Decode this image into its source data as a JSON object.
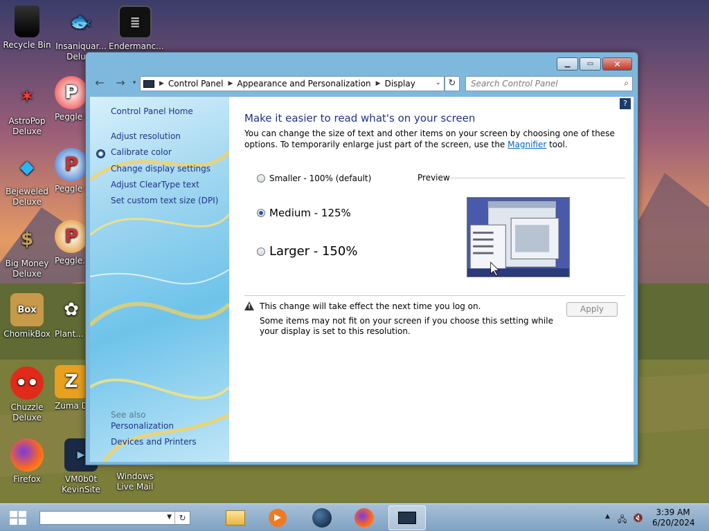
{
  "desktop": {
    "icons": [
      {
        "label": "Recycle Bin"
      },
      {
        "label": "Insaniquar... Deluxe"
      },
      {
        "label": "Endermanc..."
      },
      {
        "label": "AstroPop Deluxe"
      },
      {
        "label": "Peggle D..."
      },
      {
        "label": "Bejeweled Deluxe"
      },
      {
        "label": "Peggle N... Delu..."
      },
      {
        "label": "Big Money Deluxe"
      },
      {
        "label": "Peggle... of Warc..."
      },
      {
        "label": "ChomikBox"
      },
      {
        "label": "Plant... Zomb..."
      },
      {
        "label": "Chuzzle Deluxe"
      },
      {
        "label": "Zuma D..."
      },
      {
        "label": "Firefox"
      },
      {
        "label": "VM0b0t KevinSite"
      },
      {
        "label": "Windows Live Mail"
      }
    ]
  },
  "window": {
    "address": {
      "segments": [
        "Control Panel",
        "Appearance and Personalization",
        "Display"
      ]
    },
    "search_placeholder": "Search Control Panel",
    "sidebar": {
      "home": "Control Panel Home",
      "links": [
        "Adjust resolution",
        "Calibrate color",
        "Change display settings",
        "Adjust ClearType text",
        "Set custom text size (DPI)"
      ],
      "see_also_label": "See also",
      "see_also": [
        "Personalization",
        "Devices and Printers"
      ]
    },
    "main": {
      "heading": "Make it easier to read what's on your screen",
      "desc_pre": "You can change the size of text and other items on your screen by choosing one of these options. To temporarily enlarge just part of the screen, use the ",
      "desc_link": "Magnifier",
      "desc_post": " tool.",
      "options": [
        {
          "label": "Smaller - 100% (default)",
          "selected": false
        },
        {
          "label": "Medium - 125%",
          "selected": true
        },
        {
          "label": "Larger - 150%",
          "selected": false
        }
      ],
      "preview_label": "Preview",
      "warning_title": "This change will take effect the next time you log on.",
      "warning_detail": "Some items may not fit on your screen if you choose this setting while your display is set to this resolution.",
      "apply_label": "Apply"
    }
  },
  "taskbar": {
    "time": "3:39 AM",
    "date": "6/20/2024"
  },
  "colors": {
    "link": "#1e3287",
    "hyperlink": "#0066cc",
    "radio_selected": "#2a5aa8"
  }
}
